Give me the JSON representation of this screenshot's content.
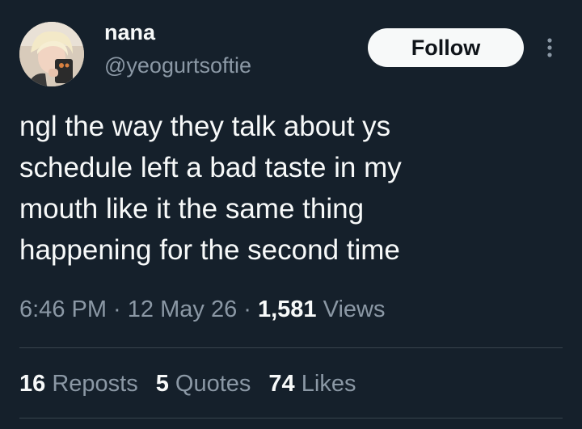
{
  "author": {
    "display_name": "nana",
    "handle": "@yeogurtsoftie"
  },
  "follow_label": "Follow",
  "more_icon": "more-vertical-icon",
  "tweet": {
    "lines": [
      "ngl the way they talk about ys",
      "schedule left a bad taste in my",
      "mouth like it the same thing",
      "happening for the second time"
    ]
  },
  "meta": {
    "time": "6:46 PM",
    "sep1": " · ",
    "date": "12 May 26",
    "sep2": " · ",
    "views_count": "1,581",
    "views_label": " Views"
  },
  "stats": {
    "reposts_count": "16",
    "reposts_label": " Reposts",
    "quotes_count": "5",
    "quotes_label": " Quotes",
    "likes_count": "74",
    "likes_label": " Likes"
  },
  "colors": {
    "background": "#15202b",
    "text": "#f7f9f9",
    "secondary": "#8b98a5",
    "divider": "#38444d",
    "follow_bg": "#f7f9f9"
  }
}
